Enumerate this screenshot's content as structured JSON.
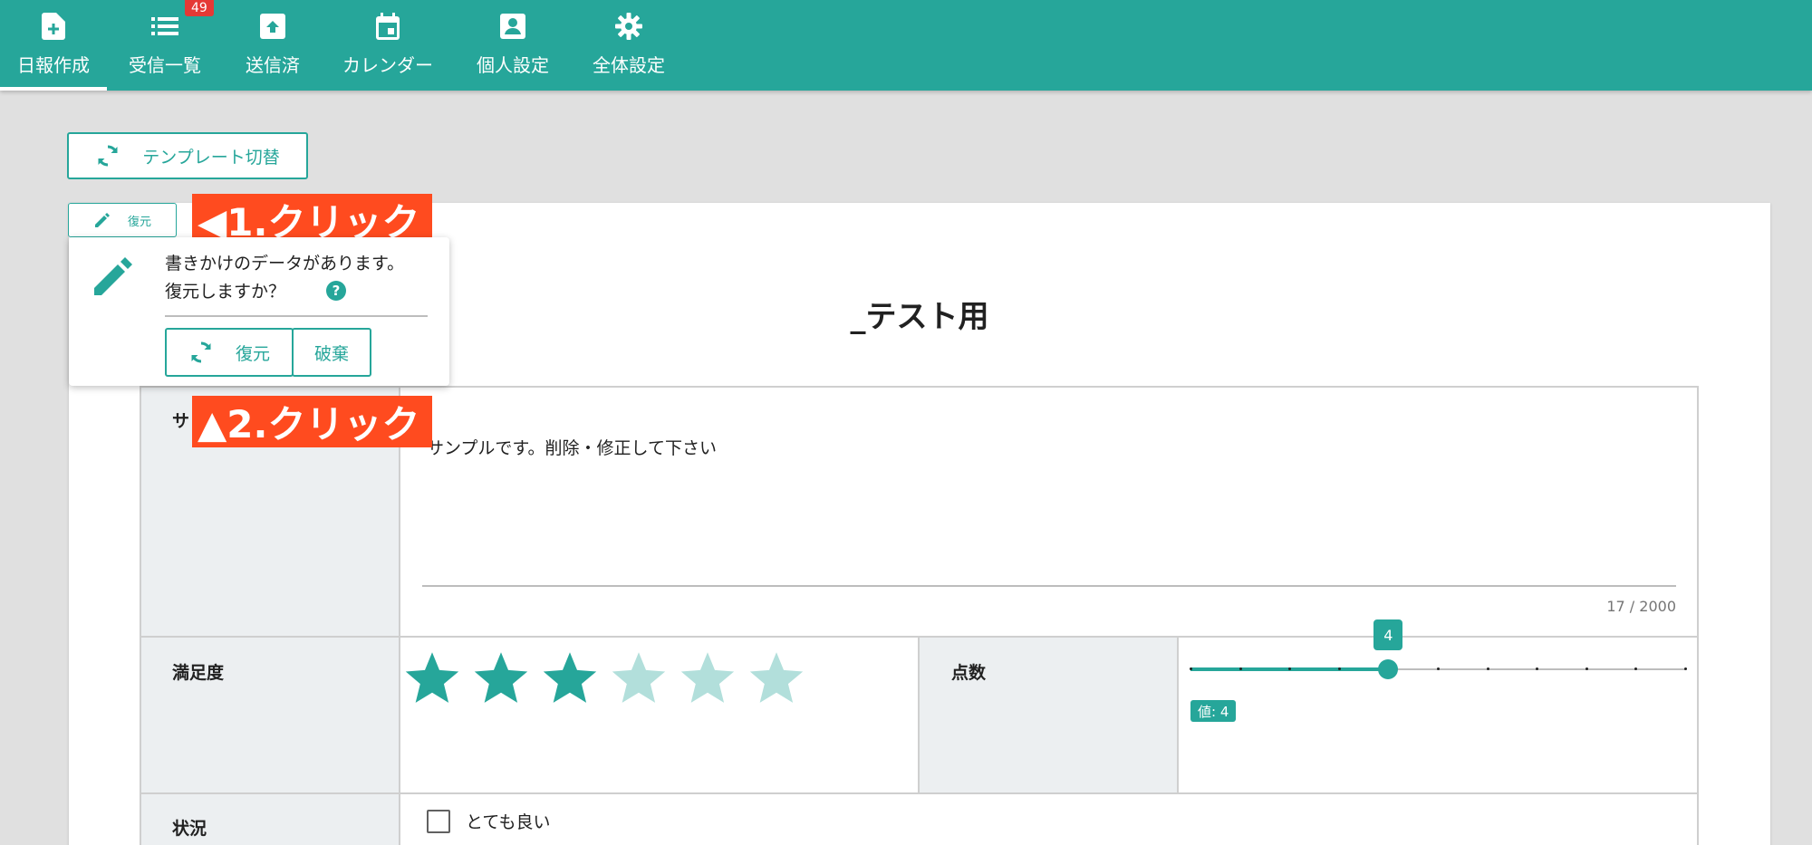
{
  "nav": {
    "items": [
      {
        "label": "日報作成",
        "icon": "new-document-icon",
        "active": true
      },
      {
        "label": "受信一覧",
        "icon": "list-icon",
        "badge": "49"
      },
      {
        "label": "送信済",
        "icon": "archive-icon"
      },
      {
        "label": "カレンダー",
        "icon": "calendar-icon"
      },
      {
        "label": "個人設定",
        "icon": "person-box-icon"
      },
      {
        "label": "全体設定",
        "icon": "gear-icon"
      }
    ]
  },
  "colors": {
    "primary": "#26a69a",
    "annotation": "#ff4b1f",
    "badge": "#e53935"
  },
  "toolbar": {
    "template_switch_label": "テンプレート切替",
    "restore_small_label": "復元"
  },
  "annotations": {
    "step1": "◀1.クリック",
    "step2": "▲2.クリック"
  },
  "popup": {
    "line1": "書きかけのデータがあります。",
    "line2": "復元しますか？",
    "help": "?",
    "restore_label": "復元",
    "discard_label": "破棄"
  },
  "form": {
    "title": "_テスト用",
    "rows": [
      {
        "label": "サ",
        "value": "サンプルです。削除・修正して下さい",
        "counter": "17 / 2000"
      },
      {
        "label": "満足度",
        "rating": 3,
        "max": 6
      },
      {
        "label": "点数",
        "slider_value": "4",
        "value_chip": "値: 4"
      },
      {
        "label": "状況",
        "option": "とても良い"
      }
    ]
  }
}
